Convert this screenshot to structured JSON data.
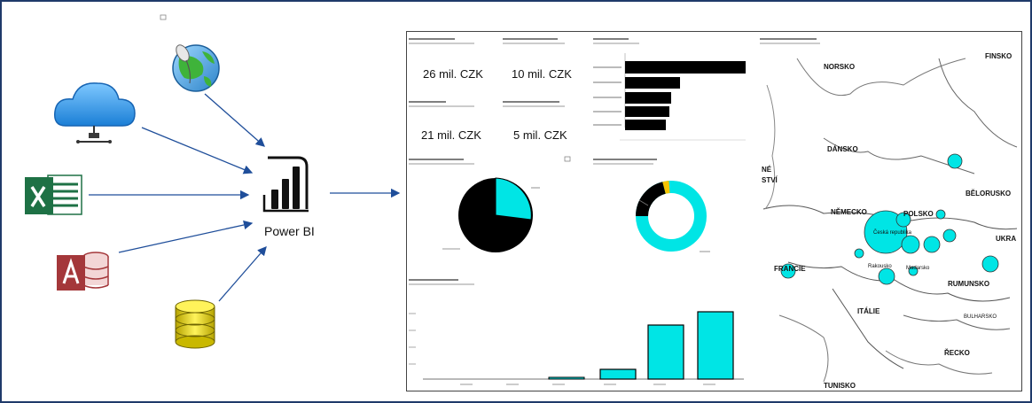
{
  "flow": {
    "hub_label": "Power BI",
    "sources": [
      "cloud-service",
      "web-globe",
      "excel-file",
      "access-database",
      "sql-database"
    ]
  },
  "dashboard": {
    "kpi_values": [
      "26 mil. CZK",
      "10 mil. CZK",
      "21 mil. CZK",
      "5 mil. CZK"
    ],
    "map_countries": {
      "norsko": "NORSKO",
      "finsko": "FINSKO",
      "dansko": "DÁNSKO",
      "svedsko_fragment_1": "NÉ",
      "svedsko_fragment_2": "STVÍ",
      "belorusko": "BĚLORUSKO",
      "nemecko": "NĚMECKO",
      "polsko": "POLSKO",
      "ukrajina": "UKRA",
      "francie": "FRANCIE",
      "rumunsko": "RUMUNSKO",
      "italie": "ITÁLIE",
      "bulharsko": "BULHARSKO",
      "recko": "ŘECKO",
      "tunisko": "TUNISKO"
    },
    "map_cities": [
      "Česká republika",
      "Madarsko",
      "Rakousko"
    ]
  },
  "colors": {
    "accent": "#00e5e5",
    "arrow": "#1f4e9a",
    "frame": "#1f3a6a",
    "bar_dark": "#000000"
  }
}
